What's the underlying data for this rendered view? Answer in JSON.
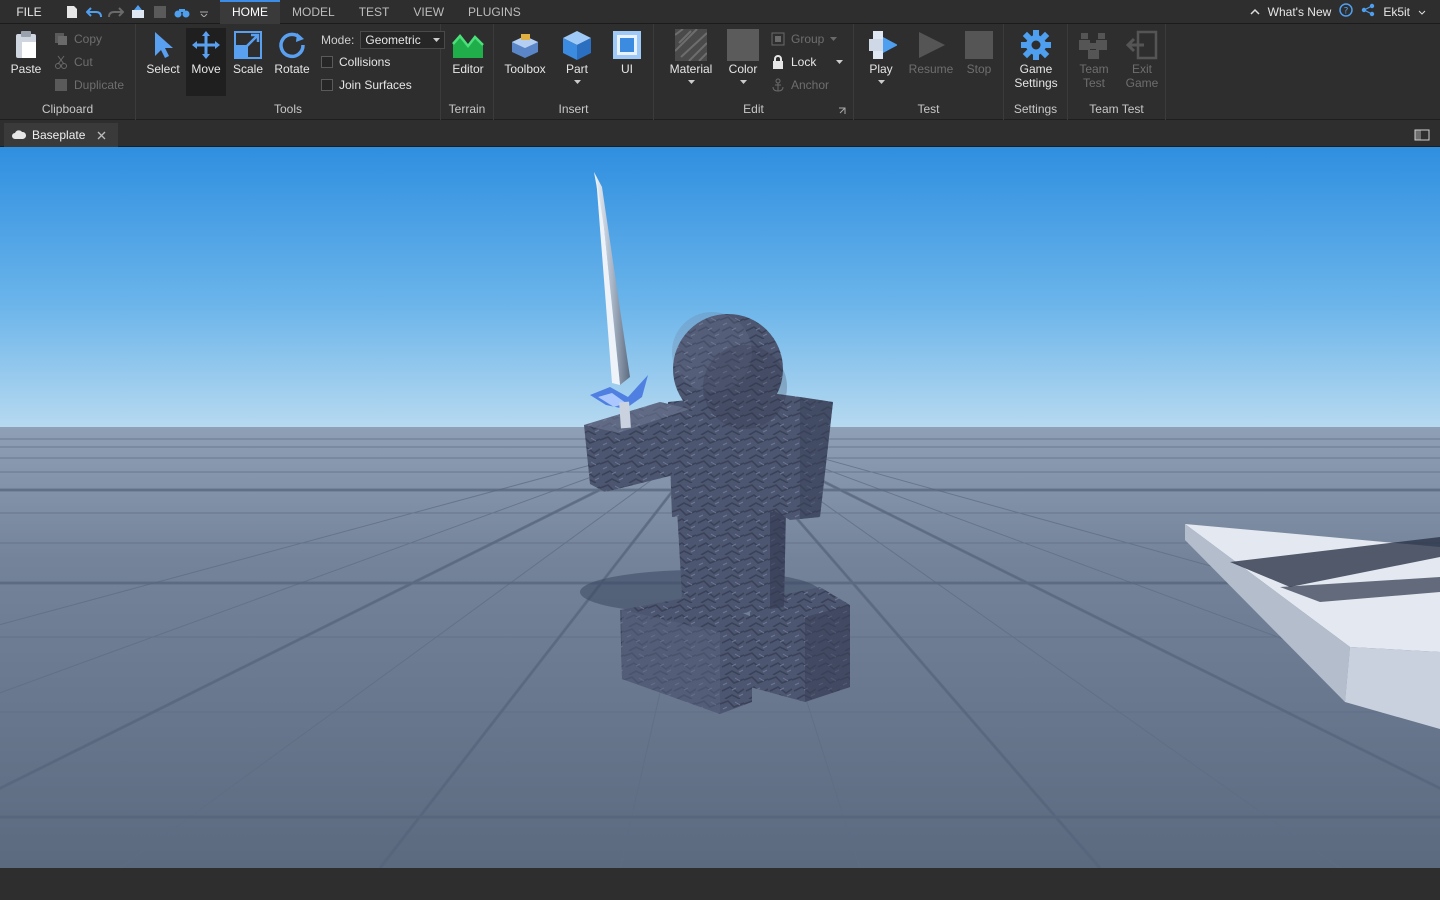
{
  "menubar": {
    "file": "FILE",
    "tabs": [
      "HOME",
      "MODEL",
      "TEST",
      "VIEW",
      "PLUGINS"
    ],
    "active_tab": "HOME",
    "whats_new": "What's New",
    "user": "Ek5it"
  },
  "ribbon": {
    "clipboard": {
      "label": "Clipboard",
      "paste": "Paste",
      "copy": "Copy",
      "cut": "Cut",
      "duplicate": "Duplicate"
    },
    "tools": {
      "label": "Tools",
      "select": "Select",
      "move": "Move",
      "scale": "Scale",
      "rotate": "Rotate",
      "mode_label": "Mode:",
      "mode_value": "Geometric",
      "collisions": "Collisions",
      "join_surfaces": "Join Surfaces"
    },
    "terrain": {
      "label": "Terrain",
      "editor": "Editor"
    },
    "insert": {
      "label": "Insert",
      "toolbox": "Toolbox",
      "part": "Part",
      "ui": "UI"
    },
    "edit": {
      "label": "Edit",
      "material": "Material",
      "color": "Color",
      "group": "Group",
      "lock": "Lock",
      "anchor": "Anchor"
    },
    "test": {
      "label": "Test",
      "play": "Play",
      "resume": "Resume",
      "stop": "Stop"
    },
    "settings": {
      "label": "Settings",
      "game_settings_1": "Game",
      "game_settings_2": "Settings"
    },
    "team_test": {
      "label": "Team Test",
      "team_test_1": "Team",
      "team_test_2": "Test",
      "exit_game_1": "Exit",
      "exit_game_2": "Game"
    }
  },
  "document": {
    "tab": "Baseplate"
  },
  "colors": {
    "accent": "#3d8de6",
    "ribbon_bg": "#2e2e2e",
    "sky_top": "#2f8fe0",
    "ground": "#6f7d93"
  }
}
